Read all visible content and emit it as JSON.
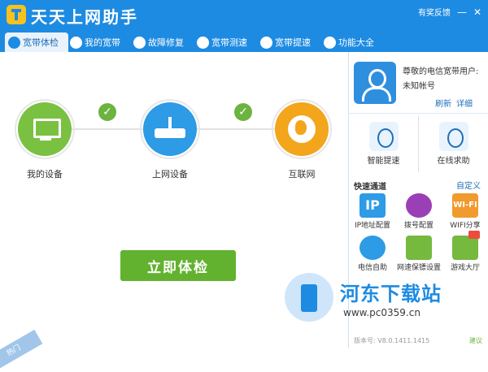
{
  "app": {
    "title": "天天上网助手"
  },
  "header": {
    "feedback": "有奖反馈",
    "minimize": "—",
    "close": "✕"
  },
  "tabs": [
    {
      "label": "宽带体检",
      "icon": "check-shield-icon",
      "active": true
    },
    {
      "label": "我的宽带",
      "icon": "globe-icon",
      "active": false
    },
    {
      "label": "故障修复",
      "icon": "toolbox-icon",
      "active": false
    },
    {
      "label": "宽带测速",
      "icon": "speedometer-icon",
      "active": false
    },
    {
      "label": "宽带提速",
      "icon": "rocket-icon",
      "active": false
    },
    {
      "label": "功能大全",
      "icon": "apps-icon",
      "active": false
    }
  ],
  "main": {
    "nodes": [
      {
        "label": "我的设备",
        "icon": "monitor-icon",
        "color": "#7ac142"
      },
      {
        "label": "上网设备",
        "icon": "router-icon",
        "color": "#2d9be5"
      },
      {
        "label": "互联网",
        "icon": "globe-icon",
        "color": "#f3a51b"
      }
    ],
    "start_button": "立即体检"
  },
  "side": {
    "user": {
      "greeting": "尊敬的电信宽带用户:",
      "account": "未知帐号",
      "refresh": "刷新",
      "detail": "详细"
    },
    "quick_actions": [
      {
        "label": "智能提速",
        "icon": "rocket-icon"
      },
      {
        "label": "在线求助",
        "icon": "support-agent-icon"
      }
    ],
    "shortcut_title": "快速通道",
    "customize": "自定义",
    "shortcuts": [
      {
        "label": "IP地址配置",
        "icon": "ip-icon",
        "icon_text": "IP",
        "color": "#2d9be5"
      },
      {
        "label": "拨号配置",
        "icon": "phone-dial-icon",
        "icon_text": "",
        "color": "#9b3fb6"
      },
      {
        "label": "WIFI分享",
        "icon": "wifi-icon",
        "icon_text": "WI-FI",
        "color": "#f19a2d"
      },
      {
        "label": "电信自助",
        "icon": "telecom-icon",
        "icon_text": "",
        "color": "#2d9be5"
      },
      {
        "label": "网速保镖设置",
        "icon": "guard-icon",
        "icon_text": "",
        "color": "#75b93f"
      },
      {
        "label": "游戏大厅",
        "icon": "gamepad-icon",
        "icon_text": "",
        "color": "#75b93f"
      }
    ],
    "version": "版本号: V8.0.1411.1415",
    "feedback": "建议"
  },
  "watermark": {
    "title": "河东下载站",
    "url": "www.pc0359.cn"
  },
  "ribbon": "热门"
}
